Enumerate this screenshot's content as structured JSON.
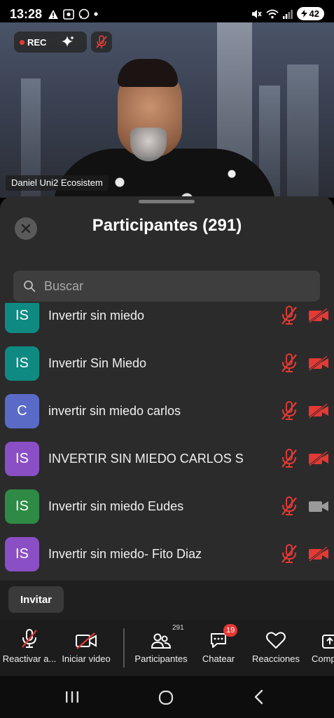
{
  "status_bar": {
    "time": "13:28",
    "battery": "42",
    "icons": [
      "warning-icon",
      "screen-record-icon",
      "whatsapp-icon",
      "dot-icon",
      "mute-icon",
      "wifi-icon",
      "signal-icon",
      "battery-icon"
    ]
  },
  "meeting_video": {
    "rec_label": "REC",
    "speaker_name": "Daniel Uni2 Ecosistem"
  },
  "participants_panel": {
    "title": "Participantes (291)",
    "search_placeholder": "Buscar",
    "participants": [
      {
        "initials": "IS",
        "name": "Invertir sin miedo",
        "avatar_color": "#0f8a82",
        "mic": "muted",
        "camera": "off"
      },
      {
        "initials": "IS",
        "name": "Invertir Sin Miedo",
        "avatar_color": "#0f8a82",
        "mic": "muted",
        "camera": "off"
      },
      {
        "initials": "C",
        "name": "invertir sin miedo carlos",
        "avatar_color": "#5a6bc7",
        "mic": "muted",
        "camera": "off"
      },
      {
        "initials": "IS",
        "name": "INVERTIR SIN MIEDO CARLOS S",
        "avatar_color": "#8a4fc4",
        "mic": "muted",
        "camera": "off"
      },
      {
        "initials": "IS",
        "name": "Invertir sin miedo Eudes",
        "avatar_color": "#2e8a44",
        "mic": "muted",
        "camera": "on"
      },
      {
        "initials": "IS",
        "name": "Invertir sin miedo- Fito Diaz",
        "avatar_color": "#8a4fc4",
        "mic": "muted",
        "camera": "off"
      }
    ],
    "invite_label": "Invitar"
  },
  "toolbar": {
    "unmute_label": "Reactivar a...",
    "start_video_label": "Iniciar video",
    "participants_label": "Participantes",
    "participants_count": "291",
    "chat_label": "Chatear",
    "chat_badge": "19",
    "reactions_label": "Reacciones",
    "share_label": "Comp"
  },
  "colors": {
    "muted_red": "#e53935",
    "sheet_bg": "#2b2b2b",
    "toolbar_bg": "#1c1c1c"
  }
}
